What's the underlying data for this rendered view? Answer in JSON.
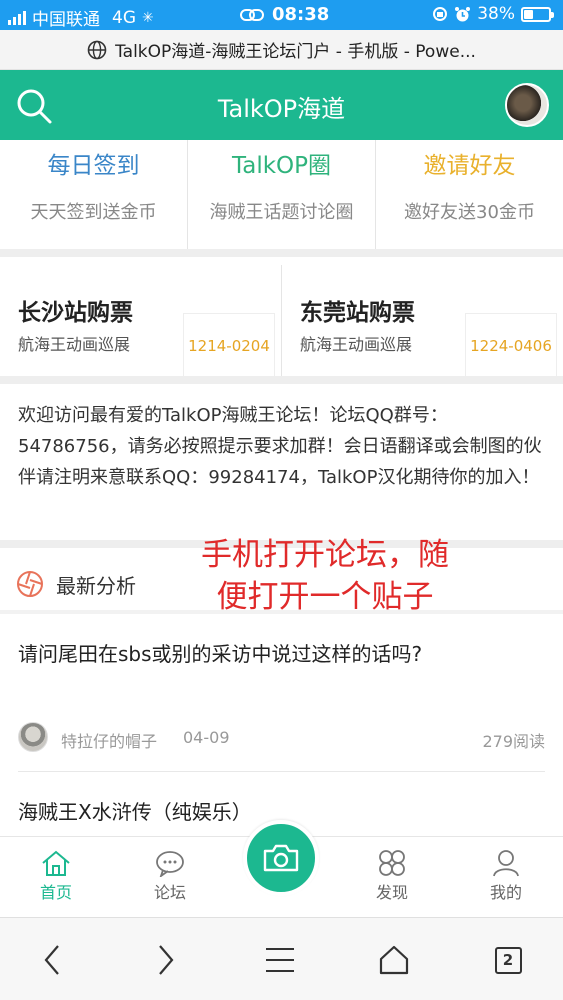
{
  "status_bar": {
    "carrier": "中国联通",
    "network": "4G",
    "time": "08:38",
    "battery": "38%",
    "battery_level": 0.38
  },
  "browser": {
    "page_title": "TalkOP海道-海贼王论坛门户 - 手机版 - Powe...",
    "open_tabs": "2"
  },
  "header": {
    "title": "TalkOP海道"
  },
  "quick_links": [
    {
      "title": "每日签到",
      "subtitle": "天天签到送金币",
      "color": "#3a86c8"
    },
    {
      "title": "TalkOP圈",
      "subtitle": "海贼王话题讨论圈",
      "color": "#2fb37c"
    },
    {
      "title": "邀请好友",
      "subtitle": "邀好友送30金币",
      "color": "#e9b12d"
    }
  ],
  "tickets": [
    {
      "title": "长沙站购票",
      "subtitle": "航海王动画巡展",
      "date": "1214-0204"
    },
    {
      "title": "东莞站购票",
      "subtitle": "航海王动画巡展",
      "date": "1224-0406"
    }
  ],
  "welcome_text": "欢迎访问最有爱的TalkOP海贼王论坛！论坛QQ群号：54786756，请务必按照提示要求加群！会日语翻译或会制图的伙伴请注明来意联系QQ：99284174，TalkOP汉化期待你的加入！",
  "section": {
    "title": "最新分析"
  },
  "annotation": {
    "line1": "手机打开论坛，随",
    "line2": "便打开一个贴子"
  },
  "posts": [
    {
      "title": "请问尾田在sbs或别的采访中说过这样的话吗?",
      "author": "特拉仔的帽子",
      "date": "04-09",
      "reads": "279阅读"
    },
    {
      "title": "海贼王X水浒传（纯娱乐）"
    }
  ],
  "tabbar": [
    {
      "label": "首页",
      "icon": "home-icon",
      "active": true
    },
    {
      "label": "论坛",
      "icon": "chat-icon",
      "active": false
    },
    {
      "label": "发现",
      "icon": "discover-icon",
      "active": false
    },
    {
      "label": "我的",
      "icon": "profile-icon",
      "active": false
    }
  ],
  "colors": {
    "accent": "#1cb890",
    "status_bar": "#1e9df0",
    "ticket_date": "#e6a523",
    "annotation": "#e02a2a"
  }
}
